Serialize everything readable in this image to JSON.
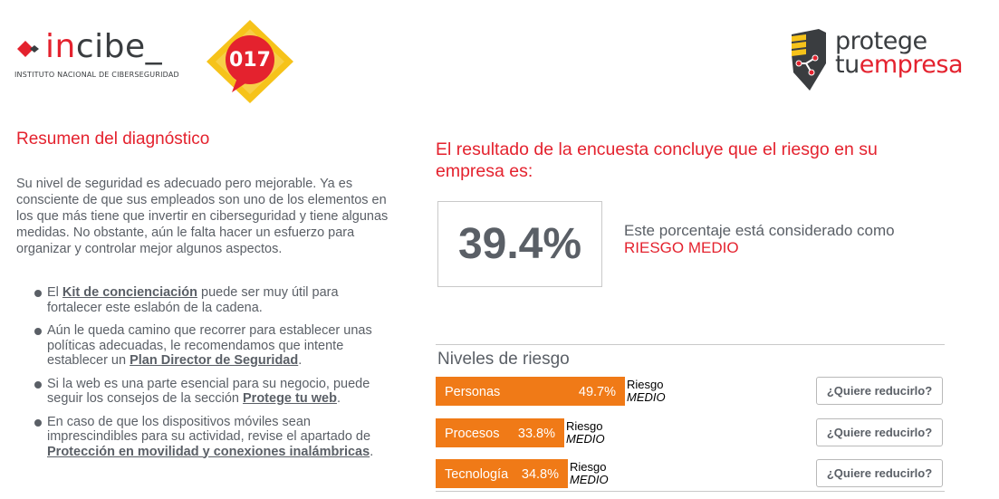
{
  "header": {
    "incibe_logo_text": "incibe_",
    "incibe_logo_red_part": "in",
    "incibe_logo_rest": "cibe_",
    "incibe_subtitle": "INSTITUTO NACIONAL DE CIBERSEGURIDAD",
    "badge_number": "017",
    "protege_line1": "protege",
    "protege_line2_a": "tu",
    "protege_line2_b": "empresa"
  },
  "summary": {
    "title": "Resumen del diagnóstico",
    "text": "Su nivel de seguridad es adecuado pero mejorable. Ya es consciente de que sus empleados son uno de los elementos en los que más tiene que invertir en ciberseguridad y tiene algunas medidas. No obstante, aún le falta hacer un esfuerzo para organizar y controlar mejor algunos aspectos.",
    "tips": [
      {
        "before": "El ",
        "link": "Kit de concienciación",
        "after": " puede ser muy útil para fortalecer este eslabón de la cadena."
      },
      {
        "before": "Aún le queda camino que recorrer para establecer unas políticas adecuadas, le recomendamos que intente establecer un ",
        "link": "Plan Director de Seguridad",
        "after": "."
      },
      {
        "before": "Si la web es una parte esencial para su negocio, puede seguir los consejos de la sección ",
        "link": "Protege tu web",
        "after": "."
      },
      {
        "before": "En caso de que los dispositivos móviles sean imprescindibles para su actividad, revise el apartado de ",
        "link": "Protección en movilidad y conexiones inalámbricas",
        "after": "."
      }
    ]
  },
  "result": {
    "title": "El resultado de la encuesta concluye que el riesgo en su empresa es:",
    "score": "39.4%",
    "score_percent": 39.4,
    "description": "Este porcentaje está considerado como",
    "level": "RIESGO MEDIO"
  },
  "levels": {
    "title": "Niveles de riesgo",
    "rows": [
      {
        "name": "Personas",
        "percent_label": "49.7%",
        "percent": 49.7,
        "level_line1": "Riesgo",
        "level_line2": "MEDIO",
        "button": "¿Quiere reducirlo?"
      },
      {
        "name": "Procesos",
        "percent_label": "33.8%",
        "percent": 33.8,
        "level_line1": "Riesgo",
        "level_line2": "MEDIO",
        "button": "¿Quiere reducirlo?"
      },
      {
        "name": "Tecnología",
        "percent_label": "34.8%",
        "percent": 34.8,
        "level_line1": "Riesgo",
        "level_line2": "MEDIO",
        "button": "¿Quiere reducirlo?"
      }
    ]
  },
  "colors": {
    "accent_red": "#e4222e",
    "bar_orange": "#f07a17",
    "text_gray": "#5a5f66"
  }
}
